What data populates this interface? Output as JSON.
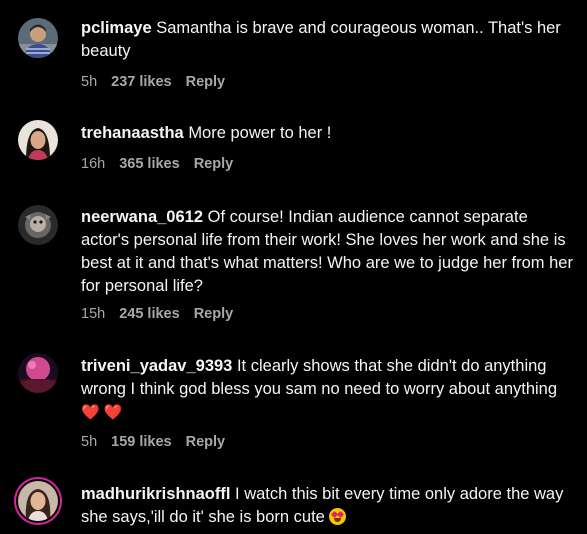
{
  "comments": [
    {
      "username": "pclimaye",
      "text": "Samantha is brave and courageous woman.. That's her beauty",
      "time": "5h",
      "likes": "237 likes",
      "reply": "Reply"
    },
    {
      "username": "trehanaastha",
      "text": "More power to her !",
      "time": "16h",
      "likes": "365 likes",
      "reply": "Reply"
    },
    {
      "username": "neerwana_0612",
      "text": "Of course! Indian audience cannot separate actor's personal life from their work! She loves her work and she is best at it and that's what matters! Who are we to judge her from her for personal life?",
      "time": "15h",
      "likes": "245 likes",
      "reply": "Reply"
    },
    {
      "username": "triveni_yadav_9393",
      "text": "It clearly shows that she didn't do anything wrong I think god bless you sam no need to worry about anything",
      "emoji": "❤️ ❤️",
      "time": "5h",
      "likes": "159 likes",
      "reply": "Reply"
    },
    {
      "username": "madhurikrishnaoffl",
      "text": "I watch this bit every time only adore the way she says,'ill do it' she is born cute",
      "emoji_name": "star-struck-emoji"
    }
  ],
  "colors": {
    "background": "#000000",
    "text": "#f5f5f5",
    "meta": "#a8a8a8",
    "heart": "#ff3040",
    "story_ring": "#d6249f"
  }
}
